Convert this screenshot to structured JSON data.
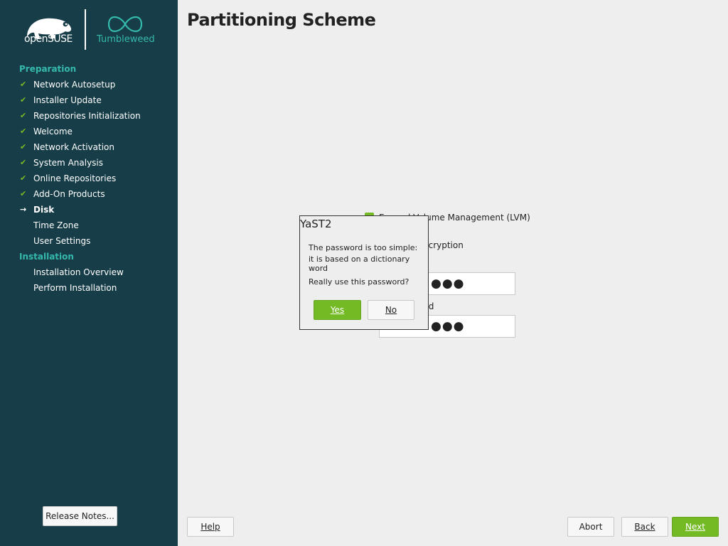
{
  "brand": {
    "opensuse_text": "openSUSE",
    "tumbleweed_text": "Tumbleweed"
  },
  "sidebar": {
    "sections": [
      {
        "label": "Preparation",
        "steps": [
          {
            "label": "Network Autosetup",
            "state": "done"
          },
          {
            "label": "Installer Update",
            "state": "done"
          },
          {
            "label": "Repositories Initialization",
            "state": "done"
          },
          {
            "label": "Welcome",
            "state": "done"
          },
          {
            "label": "Network Activation",
            "state": "done"
          },
          {
            "label": "System Analysis",
            "state": "done"
          },
          {
            "label": "Online Repositories",
            "state": "done"
          },
          {
            "label": "Add-On Products",
            "state": "done"
          },
          {
            "label": "Disk",
            "state": "current"
          },
          {
            "label": "Time Zone",
            "state": "pending"
          },
          {
            "label": "User Settings",
            "state": "pending"
          }
        ]
      },
      {
        "label": "Installation",
        "steps": [
          {
            "label": "Installation Overview",
            "state": "pending"
          },
          {
            "label": "Perform Installation",
            "state": "pending"
          }
        ]
      }
    ],
    "release_notes_label": "Release Notes..."
  },
  "main": {
    "title": "Partitioning Scheme",
    "lvm_label_left": "E",
    "lvm_label_right": "l Volume Management (LVM)",
    "encryption_label": "ncryption",
    "password_value": "●●●",
    "verify_label": "rd",
    "verify_value": "●●●"
  },
  "dialog": {
    "title": "YaST2",
    "line1": "The password is too simple:",
    "line2": "it is based on a dictionary word",
    "question": "Really use this password?",
    "yes_label": "Yes",
    "no_label": "No"
  },
  "footer": {
    "help_label": "Help",
    "abort_label": "Abort",
    "back_label": "Back",
    "next_label": "Next"
  },
  "colors": {
    "sidebar": "#173d48",
    "accent_teal": "#35b9ab",
    "accent_green": "#73ba25"
  }
}
